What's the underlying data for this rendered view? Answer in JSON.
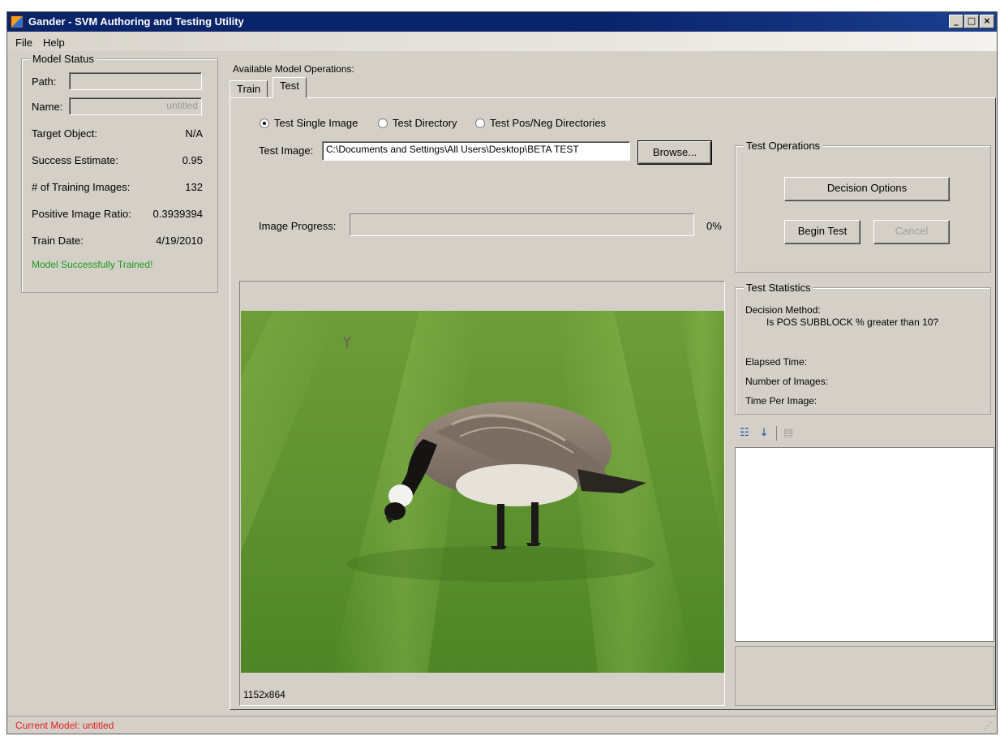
{
  "window": {
    "title": "Gander - SVM Authoring and Testing Utility",
    "controls": {
      "minimize": "_",
      "maximize": "□",
      "close": "×"
    }
  },
  "menu": {
    "items": [
      "File",
      "Help"
    ]
  },
  "model_status": {
    "legend": "Model Status",
    "path_label": "Path:",
    "path_value": "",
    "name_label": "Name:",
    "name_value": "untitled",
    "target_label": "Target Object:",
    "target_value": "N/A",
    "success_label": "Success Estimate:",
    "success_value": "0.95",
    "training_label": "# of Training Images:",
    "training_value": "132",
    "ratio_label": "Positive Image Ratio:",
    "ratio_value": "0.3939394",
    "date_label": "Train Date:",
    "date_value": "4/19/2010",
    "message": "Model Successfully Trained!",
    "message_color": "#1a9a1a"
  },
  "operations": {
    "label": "Available Model Operations:",
    "tabs": [
      {
        "label": "Train",
        "active": false
      },
      {
        "label": "Test",
        "active": true
      }
    ]
  },
  "test": {
    "radios": [
      {
        "label": "Test Single Image",
        "checked": true
      },
      {
        "label": "Test Directory",
        "checked": false
      },
      {
        "label": "Test Pos/Neg Directories",
        "checked": false
      }
    ],
    "image_label": "Test Image:",
    "image_path": "C:\\Documents and Settings\\All Users\\Desktop\\BETA TEST",
    "browse_label": "Browse...",
    "progress_label": "Image Progress:",
    "progress_percent_text": "0%",
    "progress_fraction": 0,
    "image_size": "1152x864"
  },
  "test_operations": {
    "legend": "Test Operations",
    "decision_button": "Decision Options",
    "begin_button": "Begin Test",
    "cancel_button": "Cancel"
  },
  "test_statistics": {
    "legend": "Test Statistics",
    "decision_label": "Decision Method:",
    "decision_value": "Is POS SUBBLOCK % greater than 10?",
    "elapsed_label": "Elapsed Time:",
    "count_label": "Number of Images:",
    "per_image_label": "Time Per Image:"
  },
  "property_grid": {
    "icons": [
      "categorized-icon",
      "alphabetical-icon",
      "property-pages-icon"
    ]
  },
  "statusbar": {
    "text": "Current Model: untitled",
    "color": "#e02020"
  }
}
